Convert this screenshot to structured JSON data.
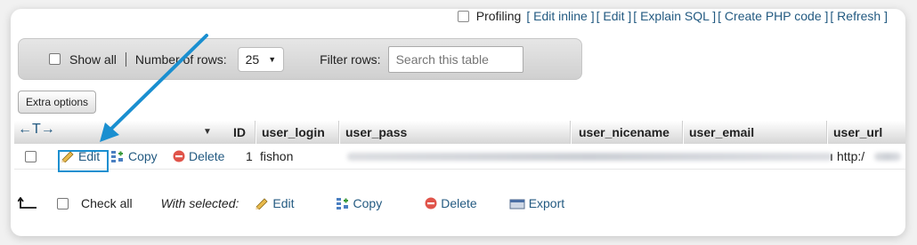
{
  "topbar": {
    "profiling_label": "Profiling",
    "links": [
      "[ Edit inline ]",
      "[ Edit ]",
      "[ Explain SQL ]",
      "[ Create PHP code ]",
      "[ Refresh ]"
    ]
  },
  "toolbar": {
    "show_all_label": "Show all",
    "num_rows_label": "Number of rows:",
    "num_rows_value": "25",
    "filter_label": "Filter rows:",
    "search_placeholder": "Search this table"
  },
  "extra_options_label": "Extra options",
  "table": {
    "columns": [
      "ID",
      "user_login",
      "user_pass",
      "user_nicename",
      "user_email",
      "user_url"
    ],
    "row": {
      "edit_label": "Edit",
      "copy_label": "Copy",
      "delete_label": "Delete",
      "id": "1",
      "user_login": "fishon",
      "user_url": "http:/"
    }
  },
  "bottom": {
    "check_all_label": "Check all",
    "with_selected_label": "With selected:",
    "edit_label": "Edit",
    "copy_label": "Copy",
    "delete_label": "Delete",
    "export_label": "Export"
  },
  "colors": {
    "annotation_arrow": "#1a8fd0",
    "link": "#235a81",
    "delete_icon": "#e0544a"
  }
}
